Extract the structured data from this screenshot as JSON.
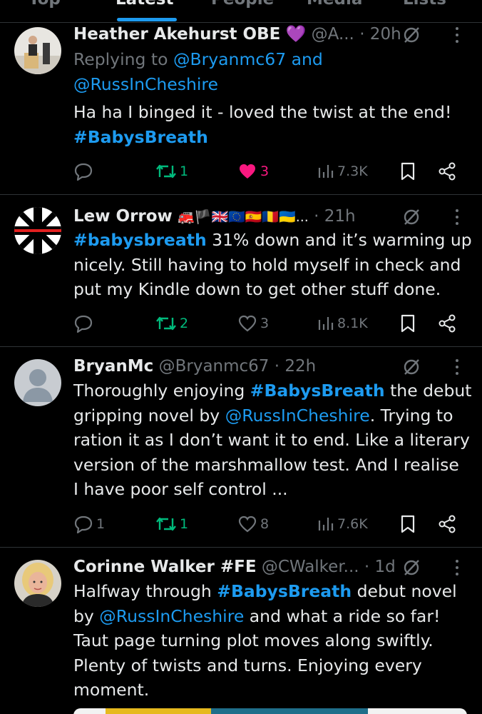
{
  "tabs": [
    {
      "label": "Top"
    },
    {
      "label": "Latest"
    },
    {
      "label": "People"
    },
    {
      "label": "Media"
    },
    {
      "label": "Lists"
    }
  ],
  "active_tab": "Latest",
  "colors": {
    "accent": "#1d9bf0",
    "retweet": "#00ba7c",
    "like": "#f91880",
    "muted": "#71767b",
    "text": "#e7e9ea"
  },
  "tweets": [
    {
      "name": "Heather Akehurst OBE",
      "badge": "💜",
      "handle": "@A...",
      "time": "· 20h",
      "reply_prefix": "Replying to ",
      "reply_user1": "@Bryanmc67",
      "reply_and": " and",
      "reply_user2": "@RussInCheshire",
      "text1": "Ha ha I binged it - loved the twist at the end!",
      "hashtag1": "#BabysBreath",
      "replies": "",
      "retweets": "1",
      "likes": "3",
      "views": "7.3K",
      "liked": true
    },
    {
      "name": "Lew Orrow",
      "badge": "🚒🏴🇬🇧🇪🇺🇪🇸🇷🇴🇺🇦...",
      "handle": "",
      "time": "· 21h",
      "hashtag1": "#babysbreath",
      "text1": " 31% down and it’s warming up",
      "text2": "nicely. Still having to hold myself in check and",
      "text3": "put my Kindle down to get other stuff done.",
      "replies": "",
      "retweets": "2",
      "likes": "3",
      "views": "8.1K"
    },
    {
      "name": "BryanMc",
      "handle": "@Bryanmc67",
      "time": "· 22h",
      "text1": "Thoroughly enjoying ",
      "hashtag1": "#BabysBreath",
      "text2": " the debut",
      "text3": "gripping novel by ",
      "mention1": "@RussInCheshire",
      "text4": ". Trying to",
      "text5": "ration it as I don’t want it to end. Like a literary",
      "text6": "version of the marshmallow test. And I realise",
      "text7": "I have poor self control ...",
      "replies": "1",
      "retweets": "1",
      "likes": "8",
      "views": "7.6K"
    },
    {
      "name": "Corinne Walker #FE",
      "handle": "@CWalker...",
      "time": "· 1d",
      "text1": "Halfway through ",
      "hashtag1": "#BabysBreath",
      "text2": " debut novel",
      "text3": "by ",
      "mention1": "@RussInCheshire",
      "text4": " and what a ride so far!",
      "text5": "Taut page turning plot moves along swiftly.",
      "text6": "Plenty of twists and turns. Enjoying every",
      "text7": "moment."
    }
  ],
  "icons": {
    "reply": "reply-icon",
    "retweet": "retweet-icon",
    "like": "heart-icon",
    "views": "views-icon",
    "bookmark": "bookmark-icon",
    "share": "share-icon",
    "grok": "grok-icon",
    "more": "more-icon"
  }
}
